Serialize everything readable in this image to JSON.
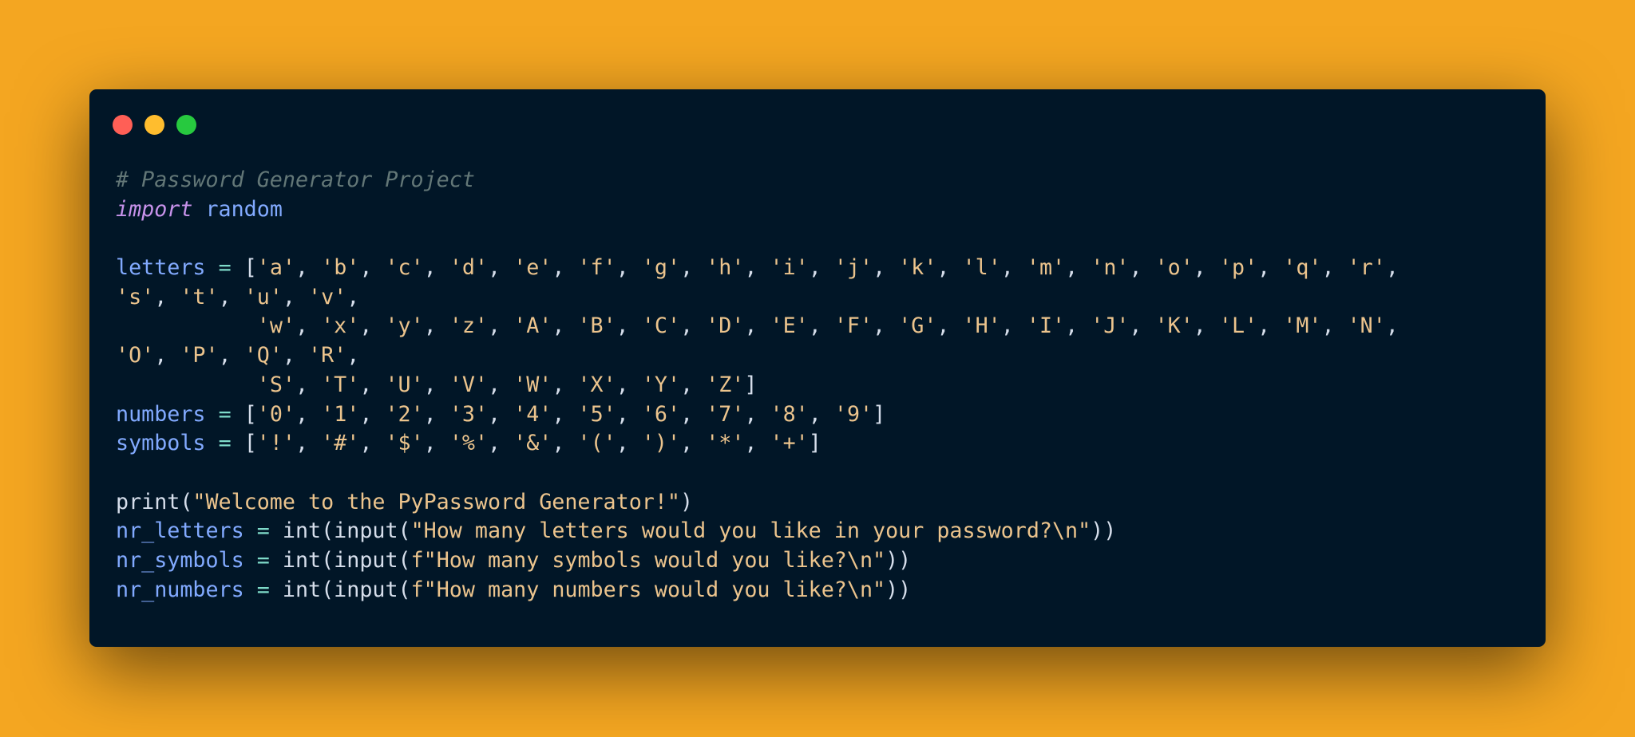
{
  "colors": {
    "background": "#f4a621",
    "window": "#011627",
    "dot_red": "#ff5f56",
    "dot_yellow": "#ffbd2e",
    "dot_green": "#27c93f",
    "comment": "#637777",
    "keyword": "#c792ea",
    "variable": "#82aaff",
    "operator": "#7fdbca",
    "string": "#ecc48d",
    "text": "#d6deeb"
  },
  "code_lines": [
    [
      {
        "t": "comment",
        "v": "# Password Generator Project"
      }
    ],
    [
      {
        "t": "kw",
        "v": "import"
      },
      {
        "t": "fn",
        "v": " "
      },
      {
        "t": "var",
        "v": "random"
      }
    ],
    [],
    [
      {
        "t": "var",
        "v": "letters"
      },
      {
        "t": "fn",
        "v": " "
      },
      {
        "t": "op",
        "v": "="
      },
      {
        "t": "fn",
        "v": " ["
      },
      {
        "t": "str",
        "v": "'a'"
      },
      {
        "t": "fn",
        "v": ", "
      },
      {
        "t": "str",
        "v": "'b'"
      },
      {
        "t": "fn",
        "v": ", "
      },
      {
        "t": "str",
        "v": "'c'"
      },
      {
        "t": "fn",
        "v": ", "
      },
      {
        "t": "str",
        "v": "'d'"
      },
      {
        "t": "fn",
        "v": ", "
      },
      {
        "t": "str",
        "v": "'e'"
      },
      {
        "t": "fn",
        "v": ", "
      },
      {
        "t": "str",
        "v": "'f'"
      },
      {
        "t": "fn",
        "v": ", "
      },
      {
        "t": "str",
        "v": "'g'"
      },
      {
        "t": "fn",
        "v": ", "
      },
      {
        "t": "str",
        "v": "'h'"
      },
      {
        "t": "fn",
        "v": ", "
      },
      {
        "t": "str",
        "v": "'i'"
      },
      {
        "t": "fn",
        "v": ", "
      },
      {
        "t": "str",
        "v": "'j'"
      },
      {
        "t": "fn",
        "v": ", "
      },
      {
        "t": "str",
        "v": "'k'"
      },
      {
        "t": "fn",
        "v": ", "
      },
      {
        "t": "str",
        "v": "'l'"
      },
      {
        "t": "fn",
        "v": ", "
      },
      {
        "t": "str",
        "v": "'m'"
      },
      {
        "t": "fn",
        "v": ", "
      },
      {
        "t": "str",
        "v": "'n'"
      },
      {
        "t": "fn",
        "v": ", "
      },
      {
        "t": "str",
        "v": "'o'"
      },
      {
        "t": "fn",
        "v": ", "
      },
      {
        "t": "str",
        "v": "'p'"
      },
      {
        "t": "fn",
        "v": ", "
      },
      {
        "t": "str",
        "v": "'q'"
      },
      {
        "t": "fn",
        "v": ", "
      },
      {
        "t": "str",
        "v": "'r'"
      },
      {
        "t": "fn",
        "v": ","
      }
    ],
    [
      {
        "t": "str",
        "v": "'s'"
      },
      {
        "t": "fn",
        "v": ", "
      },
      {
        "t": "str",
        "v": "'t'"
      },
      {
        "t": "fn",
        "v": ", "
      },
      {
        "t": "str",
        "v": "'u'"
      },
      {
        "t": "fn",
        "v": ", "
      },
      {
        "t": "str",
        "v": "'v'"
      },
      {
        "t": "fn",
        "v": ","
      }
    ],
    [
      {
        "t": "fn",
        "v": "           "
      },
      {
        "t": "str",
        "v": "'w'"
      },
      {
        "t": "fn",
        "v": ", "
      },
      {
        "t": "str",
        "v": "'x'"
      },
      {
        "t": "fn",
        "v": ", "
      },
      {
        "t": "str",
        "v": "'y'"
      },
      {
        "t": "fn",
        "v": ", "
      },
      {
        "t": "str",
        "v": "'z'"
      },
      {
        "t": "fn",
        "v": ", "
      },
      {
        "t": "str",
        "v": "'A'"
      },
      {
        "t": "fn",
        "v": ", "
      },
      {
        "t": "str",
        "v": "'B'"
      },
      {
        "t": "fn",
        "v": ", "
      },
      {
        "t": "str",
        "v": "'C'"
      },
      {
        "t": "fn",
        "v": ", "
      },
      {
        "t": "str",
        "v": "'D'"
      },
      {
        "t": "fn",
        "v": ", "
      },
      {
        "t": "str",
        "v": "'E'"
      },
      {
        "t": "fn",
        "v": ", "
      },
      {
        "t": "str",
        "v": "'F'"
      },
      {
        "t": "fn",
        "v": ", "
      },
      {
        "t": "str",
        "v": "'G'"
      },
      {
        "t": "fn",
        "v": ", "
      },
      {
        "t": "str",
        "v": "'H'"
      },
      {
        "t": "fn",
        "v": ", "
      },
      {
        "t": "str",
        "v": "'I'"
      },
      {
        "t": "fn",
        "v": ", "
      },
      {
        "t": "str",
        "v": "'J'"
      },
      {
        "t": "fn",
        "v": ", "
      },
      {
        "t": "str",
        "v": "'K'"
      },
      {
        "t": "fn",
        "v": ", "
      },
      {
        "t": "str",
        "v": "'L'"
      },
      {
        "t": "fn",
        "v": ", "
      },
      {
        "t": "str",
        "v": "'M'"
      },
      {
        "t": "fn",
        "v": ", "
      },
      {
        "t": "str",
        "v": "'N'"
      },
      {
        "t": "fn",
        "v": ","
      }
    ],
    [
      {
        "t": "str",
        "v": "'O'"
      },
      {
        "t": "fn",
        "v": ", "
      },
      {
        "t": "str",
        "v": "'P'"
      },
      {
        "t": "fn",
        "v": ", "
      },
      {
        "t": "str",
        "v": "'Q'"
      },
      {
        "t": "fn",
        "v": ", "
      },
      {
        "t": "str",
        "v": "'R'"
      },
      {
        "t": "fn",
        "v": ","
      }
    ],
    [
      {
        "t": "fn",
        "v": "           "
      },
      {
        "t": "str",
        "v": "'S'"
      },
      {
        "t": "fn",
        "v": ", "
      },
      {
        "t": "str",
        "v": "'T'"
      },
      {
        "t": "fn",
        "v": ", "
      },
      {
        "t": "str",
        "v": "'U'"
      },
      {
        "t": "fn",
        "v": ", "
      },
      {
        "t": "str",
        "v": "'V'"
      },
      {
        "t": "fn",
        "v": ", "
      },
      {
        "t": "str",
        "v": "'W'"
      },
      {
        "t": "fn",
        "v": ", "
      },
      {
        "t": "str",
        "v": "'X'"
      },
      {
        "t": "fn",
        "v": ", "
      },
      {
        "t": "str",
        "v": "'Y'"
      },
      {
        "t": "fn",
        "v": ", "
      },
      {
        "t": "str",
        "v": "'Z'"
      },
      {
        "t": "fn",
        "v": "]"
      }
    ],
    [
      {
        "t": "var",
        "v": "numbers"
      },
      {
        "t": "fn",
        "v": " "
      },
      {
        "t": "op",
        "v": "="
      },
      {
        "t": "fn",
        "v": " ["
      },
      {
        "t": "str",
        "v": "'0'"
      },
      {
        "t": "fn",
        "v": ", "
      },
      {
        "t": "str",
        "v": "'1'"
      },
      {
        "t": "fn",
        "v": ", "
      },
      {
        "t": "str",
        "v": "'2'"
      },
      {
        "t": "fn",
        "v": ", "
      },
      {
        "t": "str",
        "v": "'3'"
      },
      {
        "t": "fn",
        "v": ", "
      },
      {
        "t": "str",
        "v": "'4'"
      },
      {
        "t": "fn",
        "v": ", "
      },
      {
        "t": "str",
        "v": "'5'"
      },
      {
        "t": "fn",
        "v": ", "
      },
      {
        "t": "str",
        "v": "'6'"
      },
      {
        "t": "fn",
        "v": ", "
      },
      {
        "t": "str",
        "v": "'7'"
      },
      {
        "t": "fn",
        "v": ", "
      },
      {
        "t": "str",
        "v": "'8'"
      },
      {
        "t": "fn",
        "v": ", "
      },
      {
        "t": "str",
        "v": "'9'"
      },
      {
        "t": "fn",
        "v": "]"
      }
    ],
    [
      {
        "t": "var",
        "v": "symbols"
      },
      {
        "t": "fn",
        "v": " "
      },
      {
        "t": "op",
        "v": "="
      },
      {
        "t": "fn",
        "v": " ["
      },
      {
        "t": "str",
        "v": "'!'"
      },
      {
        "t": "fn",
        "v": ", "
      },
      {
        "t": "str",
        "v": "'#'"
      },
      {
        "t": "fn",
        "v": ", "
      },
      {
        "t": "str",
        "v": "'$'"
      },
      {
        "t": "fn",
        "v": ", "
      },
      {
        "t": "str",
        "v": "'%'"
      },
      {
        "t": "fn",
        "v": ", "
      },
      {
        "t": "str",
        "v": "'&'"
      },
      {
        "t": "fn",
        "v": ", "
      },
      {
        "t": "str",
        "v": "'('"
      },
      {
        "t": "fn",
        "v": ", "
      },
      {
        "t": "str",
        "v": "')'"
      },
      {
        "t": "fn",
        "v": ", "
      },
      {
        "t": "str",
        "v": "'*'"
      },
      {
        "t": "fn",
        "v": ", "
      },
      {
        "t": "str",
        "v": "'+'"
      },
      {
        "t": "fn",
        "v": "]"
      }
    ],
    [],
    [
      {
        "t": "fn",
        "v": "print("
      },
      {
        "t": "str",
        "v": "\"Welcome to the PyPassword Generator!\""
      },
      {
        "t": "fn",
        "v": ")"
      }
    ],
    [
      {
        "t": "var",
        "v": "nr_letters"
      },
      {
        "t": "fn",
        "v": " "
      },
      {
        "t": "op",
        "v": "="
      },
      {
        "t": "fn",
        "v": " int(input("
      },
      {
        "t": "str",
        "v": "\"How many letters would you like in your password?\\n\""
      },
      {
        "t": "fn",
        "v": "))"
      }
    ],
    [
      {
        "t": "var",
        "v": "nr_symbols"
      },
      {
        "t": "fn",
        "v": " "
      },
      {
        "t": "op",
        "v": "="
      },
      {
        "t": "fn",
        "v": " int(input("
      },
      {
        "t": "str",
        "v": "f\"How many symbols would you like?\\n\""
      },
      {
        "t": "fn",
        "v": "))"
      }
    ],
    [
      {
        "t": "var",
        "v": "nr_numbers"
      },
      {
        "t": "fn",
        "v": " "
      },
      {
        "t": "op",
        "v": "="
      },
      {
        "t": "fn",
        "v": " int(input("
      },
      {
        "t": "str",
        "v": "f\"How many numbers would you like?\\n\""
      },
      {
        "t": "fn",
        "v": "))"
      }
    ]
  ]
}
